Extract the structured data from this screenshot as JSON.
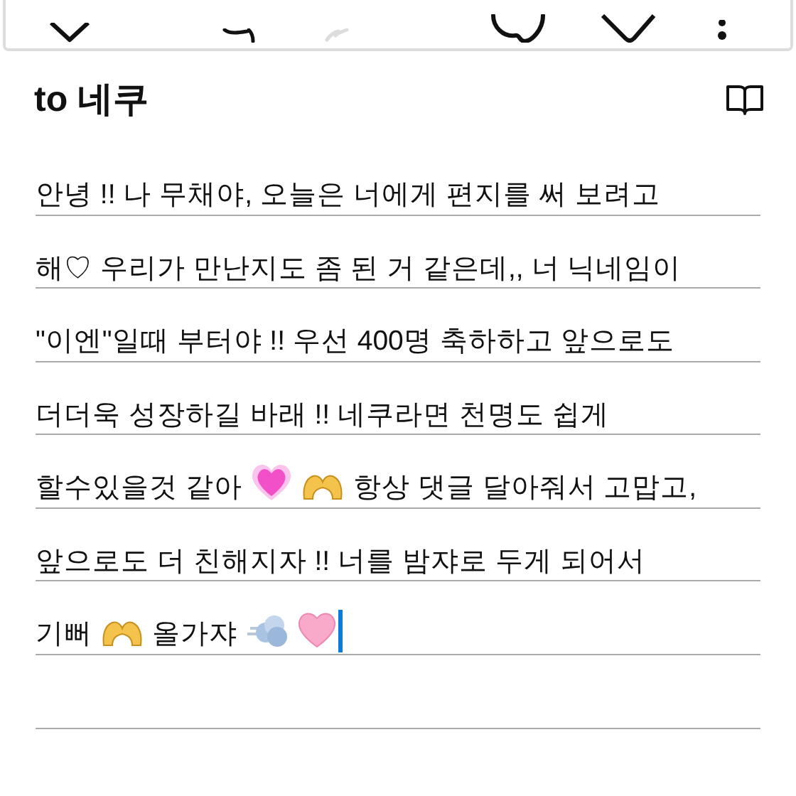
{
  "toolbar": [
    {
      "kind": "shape"
    },
    {
      "kind": "undo",
      "disabled": false
    },
    {
      "kind": "redo",
      "disabled": true
    },
    {
      "kind": "palette"
    },
    {
      "kind": "label"
    },
    {
      "kind": "more"
    }
  ],
  "note": {
    "title": "to 네쿠",
    "cursor": true,
    "lines": [
      [
        {
          "text": "안녕 !! 나 무채야, 오늘은 너에게 편지를 써 보려고"
        }
      ],
      [
        {
          "text": "해♡ 우리가 만난지도 좀 된 거 같은데,, 너 닉네임이"
        }
      ],
      [
        {
          "text": "\"이엔\"일때 부터야 !! 우선 400명 축하하고 앞으로도"
        }
      ],
      [
        {
          "text": "더더욱 성장하길 바래 !! 네쿠라면 천명도 쉽게"
        }
      ],
      [
        {
          "text": "할수있을것 같아"
        },
        {
          "kind": "growing-heart"
        },
        {
          "kind": "heart-hands"
        },
        {
          "text": "항상 댓글 달아줘서 고맙고,"
        }
      ],
      [
        {
          "text": "앞으로도 더 친해지자 !! 너를 밤쟈로 두게 되어서"
        }
      ],
      [
        {
          "text": "기뻐"
        },
        {
          "kind": "heart-hands"
        },
        {
          "text": "올가쟈"
        },
        {
          "kind": "dash"
        },
        {
          "kind": "pink-heart"
        }
      ]
    ]
  }
}
